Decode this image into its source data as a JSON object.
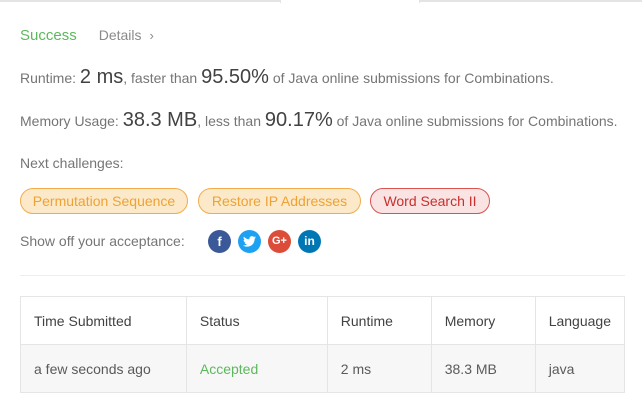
{
  "colors": {
    "success": "#5cb85c",
    "chip_orange": "#eea236",
    "chip_red": "#c9302c",
    "facebook": "#3b5998",
    "twitter": "#1da1f2",
    "google_plus": "#dd4b39",
    "linkedin": "#0077b5"
  },
  "status": {
    "label": "Success",
    "details_label": "Details",
    "chevron": "›"
  },
  "runtime": {
    "prefix": "Runtime: ",
    "value": "2 ms",
    "mid": ", faster than ",
    "percent": "95.50%",
    "suffix": " of Java online submissions for Combinations."
  },
  "memory": {
    "prefix": "Memory Usage: ",
    "value": "38.3 MB",
    "mid": ", less than ",
    "percent": "90.17%",
    "suffix": " of Java online submissions for Combinations."
  },
  "next": {
    "label": "Next challenges:",
    "challenges": [
      "Permutation Sequence",
      "Restore IP Addresses",
      "Word Search II"
    ]
  },
  "share": {
    "label": "Show off your acceptance:",
    "icons": [
      {
        "name": "facebook-icon",
        "glyph": "f"
      },
      {
        "name": "twitter-icon",
        "glyph": "t"
      },
      {
        "name": "google-plus-icon",
        "glyph": "G+"
      },
      {
        "name": "linkedin-icon",
        "glyph": "in"
      }
    ]
  },
  "submissions": {
    "headers": [
      "Time Submitted",
      "Status",
      "Runtime",
      "Memory",
      "Language"
    ],
    "rows": [
      [
        "a few seconds ago",
        "Accepted",
        "2 ms",
        "38.3 MB",
        "java"
      ]
    ]
  }
}
